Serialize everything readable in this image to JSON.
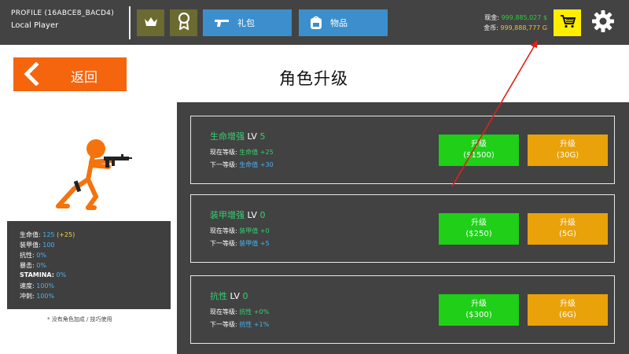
{
  "header": {
    "profile_id": "PROFILE (16ABCE8_BACD4)",
    "player_name": "Local Player",
    "crown_icon": "crown-icon",
    "award_icon": "award-icon",
    "gift_button_label": "礼包",
    "items_button_label": "物品",
    "cash_label": "现金:",
    "cash_value": "999,885,027 $",
    "gold_label": "金币:",
    "gold_value": "999,888,777 G",
    "colors": {
      "bar": "#434343",
      "button_blue": "#3c8fcc",
      "cart": "#ffee00"
    }
  },
  "back_button_label": "返回",
  "page_title": "角色升级",
  "stats": {
    "hp_label": "生命值:",
    "hp_value": "125",
    "hp_bonus": "(+25)",
    "armor_label": "装甲值:",
    "armor_value": "100",
    "resist_label": "抗性:",
    "resist_value": "0%",
    "crit_label": "暴击:",
    "crit_value": "0%",
    "stamina_label": "STAMINA:",
    "stamina_value": "0%",
    "speed_label": "速度:",
    "speed_value": "100%",
    "dash_label": "冲刺:",
    "dash_value": "100%"
  },
  "note": "* 没有角色加成 / 技巧使用",
  "upgrades": [
    {
      "name": "生命增强",
      "lv_label": "LV",
      "lv": "5",
      "current_label": "现在等级:",
      "current_stat": "生命值",
      "current_value": "+25",
      "next_label": "下一等级:",
      "next_stat": "生命值",
      "next_value": "+30",
      "cash_btn_label": "升级",
      "cash_price": "($1500)",
      "gold_btn_label": "升级",
      "gold_price": "(30G)"
    },
    {
      "name": "装甲增强",
      "lv_label": "LV",
      "lv": "0",
      "current_label": "现在等级:",
      "current_stat": "装甲值",
      "current_value": "+0",
      "next_label": "下一等级:",
      "next_stat": "装甲值",
      "next_value": "+5",
      "cash_btn_label": "升级",
      "cash_price": "($250)",
      "gold_btn_label": "升级",
      "gold_price": "(5G)"
    },
    {
      "name": "抗性",
      "lv_label": "LV",
      "lv": "0",
      "current_label": "现在等级:",
      "current_stat": "抗性",
      "current_value": "+0%",
      "next_label": "下一等级:",
      "next_stat": "抗性",
      "next_value": "+1%",
      "cash_btn_label": "升级",
      "cash_price": "($300)",
      "gold_btn_label": "升级",
      "gold_price": "(6G)"
    }
  ],
  "colors": {
    "accent_orange": "#f5650d",
    "upgrade_green": "#1fcf18",
    "upgrade_gold": "#eaa20a",
    "stat_green": "#35d16f",
    "stat_blue": "#4ab2f2",
    "annotation_red": "#e0201a"
  }
}
